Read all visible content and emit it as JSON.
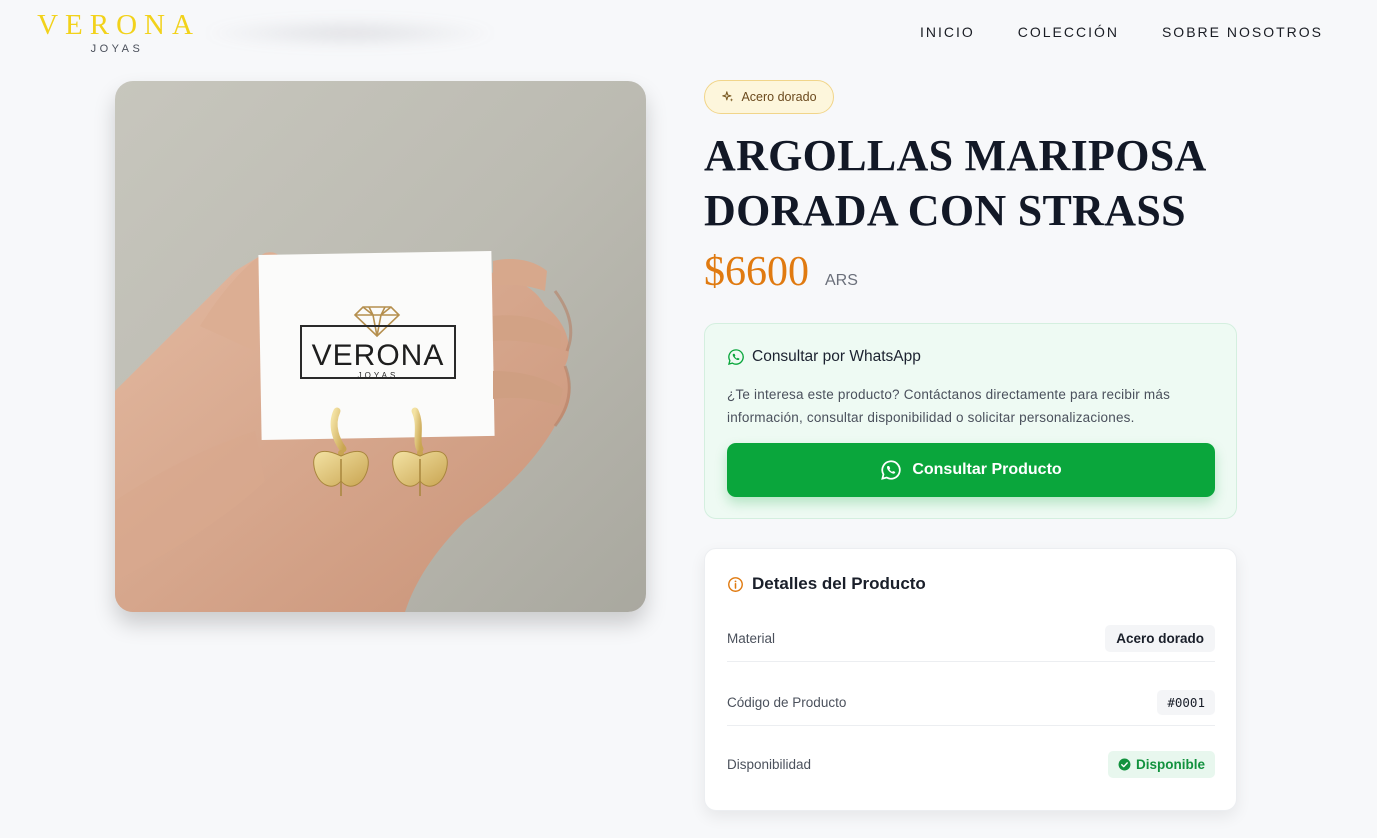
{
  "header": {
    "brand_name": "VERONA",
    "brand_sub": "JOYAS",
    "nav": [
      "INICIO",
      "COLECCIÓN",
      "SOBRE NOSOTROS"
    ]
  },
  "product": {
    "image_card_brand": "VERONA",
    "image_card_sub": "JOYAS",
    "badge": "Acero dorado",
    "title": "ARGOLLAS MARIPOSA DORADA CON STRASS",
    "price": "$6600",
    "currency": "ARS"
  },
  "whatsapp": {
    "heading": "Consultar por WhatsApp",
    "description": "¿Te interesa este producto? Contáctanos directamente para recibir más información, consultar disponibilidad o solicitar personalizaciones.",
    "button_label": "Consultar Producto"
  },
  "details": {
    "heading": "Detalles del Producto",
    "material_label": "Material",
    "material_value": "Acero dorado",
    "code_label": "Código de Producto",
    "code_value": "#0001",
    "availability_label": "Disponibilidad",
    "availability_value": "Disponible"
  },
  "colors": {
    "brand": "#f2d21b",
    "price": "#e07a10",
    "whatsapp": "#0aa63c",
    "available": "#12923e"
  },
  "icons": {
    "badge": "sparkles-icon",
    "whatsapp": "whatsapp-icon",
    "details": "info-circle-icon",
    "available": "check-circle-icon"
  }
}
